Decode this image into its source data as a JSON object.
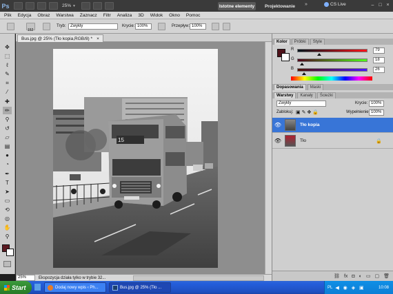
{
  "app": {
    "logo": "Ps",
    "zoom": "25%",
    "workspace_active": "Istotne elementy",
    "workspace_other": "Projektowanie",
    "more": "»",
    "cs_live": "CS Live"
  },
  "menu": [
    "Plik",
    "Edycja",
    "Obraz",
    "Warstwa",
    "Zaznacz",
    "Filtr",
    "Analiza",
    "3D",
    "Widok",
    "Okno",
    "Pomoc"
  ],
  "options": {
    "brush_size": "152",
    "mode_label": "Tryb:",
    "mode_value": "Zwykły",
    "opacity_label": "Krycie:",
    "opacity_value": "100%",
    "flow_label": "Przepływ:",
    "flow_value": "100%"
  },
  "document": {
    "tab_title": "Bus.jpg @ 25% (Tło kopia,RGB/8) *",
    "close": "×",
    "status_zoom": "25%",
    "status_message": "Ekspozycja działa tylko w trybie 32..."
  },
  "color_panel": {
    "tabs": [
      "Kolor",
      "Próbki",
      "Style"
    ],
    "r_label": "R",
    "g_label": "G",
    "b_label": "B",
    "r": 79,
    "g": 18,
    "b": 26,
    "foreground": "#4f121a"
  },
  "adjust_tabs": [
    "Dopasowania",
    "Maski"
  ],
  "layers_panel": {
    "tabs": [
      "Warstwy",
      "Kanały",
      "Ścieżki"
    ],
    "blend_mode": "Zwykły",
    "opacity_label": "Krycie:",
    "opacity": "100%",
    "lock_label": "Zablokuj:",
    "fill_label": "Wypełnienie:",
    "fill": "100%",
    "layers": [
      {
        "name": "Tło kopia",
        "selected": true
      },
      {
        "name": "Tło",
        "selected": false
      }
    ]
  },
  "taskbar": {
    "start": "Start",
    "buttons": [
      "Dodaj nowy wpis ‹ Ph...",
      "Bus.jpg @ 25% (Tło ..."
    ],
    "lang": "PL",
    "clock": "10:08"
  }
}
